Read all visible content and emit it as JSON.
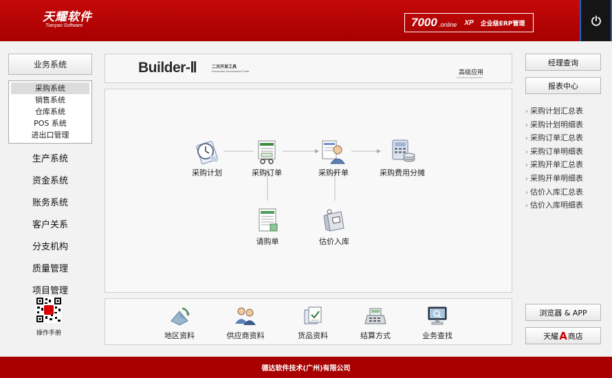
{
  "header": {
    "logo_cn": "天耀软件",
    "logo_en": "Tianyao Software",
    "product_num": "7000",
    "product_online": ".online",
    "product_xp": "XP",
    "product_erp": "企业级ERP管理",
    "power_icon": "power-icon"
  },
  "left_nav": {
    "title": "业务系统",
    "sub_items": [
      {
        "label": "采购系统",
        "active": true
      },
      {
        "label": "销售系统",
        "active": false
      },
      {
        "label": "仓库系统",
        "active": false
      },
      {
        "label": "POS 系统",
        "active": false
      },
      {
        "label": "进出口管理",
        "active": false
      }
    ],
    "items": [
      "生产系统",
      "资金系统",
      "账务系统",
      "客户关系",
      "分支机构",
      "质量管理",
      "项目管理"
    ],
    "qr_label": "操作手册",
    "qr_badge": "APP"
  },
  "banner": {
    "title": "Builder-Ⅱ",
    "cn": "二次开发工具",
    "en": "Secondary Development Tools",
    "advanced_cn": "高级应用",
    "advanced_en": "Advanced Application"
  },
  "flow": {
    "nodes": [
      {
        "id": "plan",
        "label": "采购计划",
        "icon": "clipboard-clock-icon"
      },
      {
        "id": "order",
        "label": "采购订单",
        "icon": "order-document-icon"
      },
      {
        "id": "invoice",
        "label": "采购开单",
        "icon": "person-document-icon"
      },
      {
        "id": "fee",
        "label": "采购费用分摊",
        "icon": "calculator-coins-icon"
      },
      {
        "id": "request",
        "label": "请购单",
        "icon": "request-form-icon"
      },
      {
        "id": "estimate",
        "label": "估价入库",
        "icon": "bag-tag-icon"
      }
    ]
  },
  "tools": [
    {
      "label": "地区资料",
      "icon": "region-icon"
    },
    {
      "label": "供应商资料",
      "icon": "supplier-icon"
    },
    {
      "label": "货品资料",
      "icon": "goods-icon"
    },
    {
      "label": "结算方式",
      "icon": "cash-register-icon"
    },
    {
      "label": "业务查找",
      "icon": "monitor-search-icon"
    }
  ],
  "right": {
    "manager_query": "经理查询",
    "report_center": "报表中心",
    "reports": [
      "采购计划汇总表",
      "采购计划明细表",
      "采购订单汇总表",
      "采购订单明细表",
      "采购开单汇总表",
      "采购开单明细表",
      "估价入库汇总表",
      "估价入库明细表"
    ],
    "browser_app": "浏览器 & APP",
    "shop_left": "天耀",
    "shop_a": "A",
    "shop_right": "商店"
  },
  "footer": {
    "company": "德达软件技术(广州)有限公司"
  },
  "colors": {
    "brand_red": "#a80000",
    "power_bg": "#151515",
    "power_border": "#1d63c9"
  }
}
